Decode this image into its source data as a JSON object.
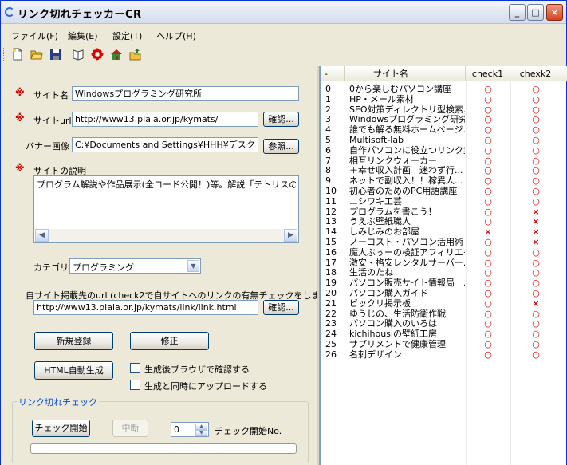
{
  "window": {
    "title": "リンク切れチェッカーCR",
    "controls": {
      "minimize": "_",
      "maximize": "□",
      "close": "×"
    }
  },
  "menu": [
    "ファイル(F)",
    "編集(E)",
    "設定(T)",
    "ヘルプ(H)"
  ],
  "toolbar_icons": [
    "new-file-icon",
    "open-folder-icon",
    "save-icon",
    "book-icon",
    "red-flower-icon",
    "house-icon",
    "upload-folder-icon"
  ],
  "form": {
    "required_mark": "※",
    "site_name_label": "サイト名",
    "site_name_value": "Windowsプログラミング研究所",
    "site_url_label": "サイトurl",
    "site_url_value": "http://www13.plala.or.jp/kymats/",
    "confirm_label": "確認...",
    "banner_label": "バナー画像",
    "banner_value": "C:¥Documents and Settings¥HHH¥デスクトップ",
    "browse_label": "参照...",
    "desc_label": "サイトの説明",
    "desc_value": "プログラム解説や作品展示(全コード公開！)等。解説「テトリスの作り方",
    "category_label": "カテゴリ",
    "category_value": "プログラミング",
    "link_url_label": "自サイト掲載先のurl (check2で自サイトへのリンクの有無チェックをします。)",
    "link_url_value": "http://www13.plala.or.jp/kymats/link/link.html",
    "confirm2_label": "確認...",
    "new_register_label": "新規登録",
    "modify_label": "修正",
    "html_gen_label": "HTML自動生成",
    "check_browser_label": "生成後ブラウザで確認する",
    "check_upload_label": "生成と同時にアップロードする"
  },
  "link_check": {
    "group_title": "リンク切れチェック",
    "start_label": "チェック開始",
    "stop_label": "中断",
    "start_no_value": "0",
    "start_no_label": "チェック開始No.",
    "progress": 0
  },
  "list": {
    "columns": [
      "-",
      "サイト名",
      "check1",
      "chexk2"
    ],
    "rows": [
      {
        "no": "0",
        "name": "0から楽しむパソコン講座",
        "c1": "○",
        "c2": "○"
      },
      {
        "no": "1",
        "name": "HP・メール素材",
        "c1": "○",
        "c2": "○"
      },
      {
        "no": "2",
        "name": "SEO対策ディレクトリ型検索...",
        "c1": "○",
        "c2": "○"
      },
      {
        "no": "3",
        "name": "Windowsプログラミング研究所",
        "c1": "○",
        "c2": "○"
      },
      {
        "no": "4",
        "name": "誰でも解る無料ホームページ...",
        "c1": "○",
        "c2": "○"
      },
      {
        "no": "5",
        "name": "Multisoft-lab",
        "c1": "○",
        "c2": "○"
      },
      {
        "no": "6",
        "name": "自作パソコンに役立つリンク集",
        "c1": "○",
        "c2": "○"
      },
      {
        "no": "7",
        "name": "相互リンクウォーカー",
        "c1": "○",
        "c2": "○"
      },
      {
        "no": "8",
        "name": "＋幸せ収入計画　迷わず行...",
        "c1": "○",
        "c2": "○"
      },
      {
        "no": "9",
        "name": "ネットで副収入！！稼異人...",
        "c1": "○",
        "c2": "○"
      },
      {
        "no": "10",
        "name": "初心者のためのPC用語講座",
        "c1": "○",
        "c2": "○"
      },
      {
        "no": "11",
        "name": "ニシワキ工芸",
        "c1": "○",
        "c2": "○"
      },
      {
        "no": "12",
        "name": "プログラムを書こう！",
        "c1": "○",
        "c2": "×"
      },
      {
        "no": "13",
        "name": "うえぶ壁紙職人",
        "c1": "○",
        "c2": "×"
      },
      {
        "no": "14",
        "name": "しみじみのお部屋",
        "c1": "×",
        "c2": "×"
      },
      {
        "no": "15",
        "name": "ノーコスト・パソコン活用術",
        "c1": "○",
        "c2": "×"
      },
      {
        "no": "16",
        "name": "魔人ぶぅーの検証アフィリエイト",
        "c1": "○",
        "c2": "○"
      },
      {
        "no": "17",
        "name": "激安・格安レンタルサーバー...",
        "c1": "○",
        "c2": "○"
      },
      {
        "no": "18",
        "name": "生活のたね",
        "c1": "○",
        "c2": "○"
      },
      {
        "no": "19",
        "name": "パソコン販売サイト情報局　...",
        "c1": "○",
        "c2": "○"
      },
      {
        "no": "20",
        "name": "パソコン購入ガイド",
        "c1": "○",
        "c2": "○"
      },
      {
        "no": "21",
        "name": "ビックリ掲示板",
        "c1": "○",
        "c2": "×"
      },
      {
        "no": "22",
        "name": "ゆうじの、生活防衛作戦",
        "c1": "○",
        "c2": "○"
      },
      {
        "no": "23",
        "name": "パソコン購入のいろは",
        "c1": "○",
        "c2": "○"
      },
      {
        "no": "24",
        "name": "kichihousiの壁紙工房",
        "c1": "○",
        "c2": "○"
      },
      {
        "no": "25",
        "name": "サプリメントで健康管理",
        "c1": "○",
        "c2": "○"
      },
      {
        "no": "26",
        "name": "名刺デザイン",
        "c1": "○",
        "c2": "○"
      }
    ]
  }
}
